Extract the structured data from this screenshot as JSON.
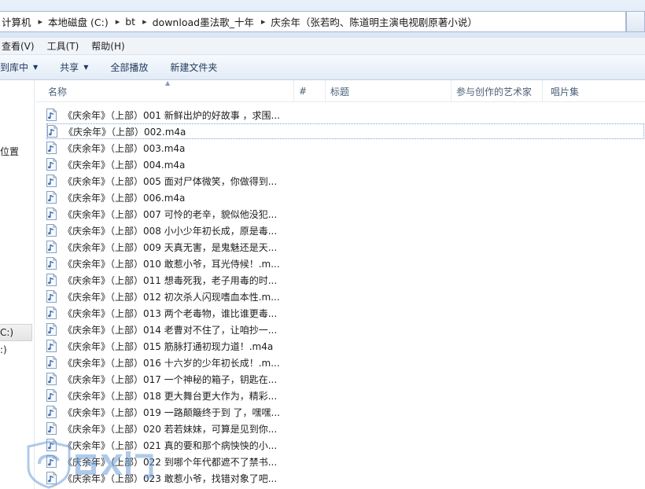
{
  "address_bar": {
    "crumbs": [
      "计算机",
      "本地磁盘 (C:)",
      "bt",
      "download墨法歌_十年",
      "庆余年（张若昀、陈道明主演电视剧原著小说）"
    ]
  },
  "menu": {
    "items": [
      "查看(V)",
      "工具(T)",
      "帮助(H)"
    ]
  },
  "toolbar": {
    "include_library": "到库中",
    "share": "共享",
    "play_all": "全部播放",
    "new_folder": "新建文件夹"
  },
  "nav": {
    "items": [
      "位置",
      "C:)",
      ":)"
    ]
  },
  "columns": {
    "name": "名称",
    "number": "#",
    "title": "标题",
    "artist": "参与创作的艺术家",
    "album": "唱片集"
  },
  "files": [
    "《庆余年》（上部）001 新鲜出炉的好故事 ，求围...",
    "《庆余年》（上部）002.m4a",
    "《庆余年》（上部）003.m4a",
    "《庆余年》（上部）004.m4a",
    "《庆余年》（上部）005 面对尸体微笑，你做得到...",
    "《庆余年》（上部）006.m4a",
    "《庆余年》（上部）007 可怜的老辛，貌似他没犯...",
    "《庆余年》（上部）008 小小少年初长成，原是毒...",
    "《庆余年》（上部）009 天真无害，是鬼魅还是天...",
    "《庆余年》（上部）010 敢惹小爷，耳光侍候！.m...",
    "《庆余年》（上部）011 想毒死我，老子用毒的时...",
    "《庆余年》（上部）012 初次杀人闪现嗜血本性.m...",
    "《庆余年》（上部）013 两个老毒物，谁比谁更毒...",
    "《庆余年》（上部）014 老曹对不住了，让咱抄一...",
    "《庆余年》（上部）015 筋脉打通初现力道！.m4a",
    "《庆余年》（上部）016 十六岁的少年初长成！.m...",
    "《庆余年》（上部）017 一个神秘的箱子，钥匙在...",
    "《庆余年》（上部）018 更大舞台更大作为，精彩...",
    "《庆余年》（上部）019 一路颠簸终于到 了，嘿嘿...",
    "《庆余年》（上部）020 若若妹妹，可算是见到你...",
    "《庆余年》（上部）021 真的要和那个病怏怏的小...",
    "《庆余年》（上部）022 到哪个年代都遮不了禁书...",
    "《庆余年》（上部）023 敢惹小爷，找错对象了吧..."
  ],
  "colors": {
    "address_bg": "#dce8f6",
    "accent": "#1e395b",
    "file_icon": "#3f6fb4"
  }
}
